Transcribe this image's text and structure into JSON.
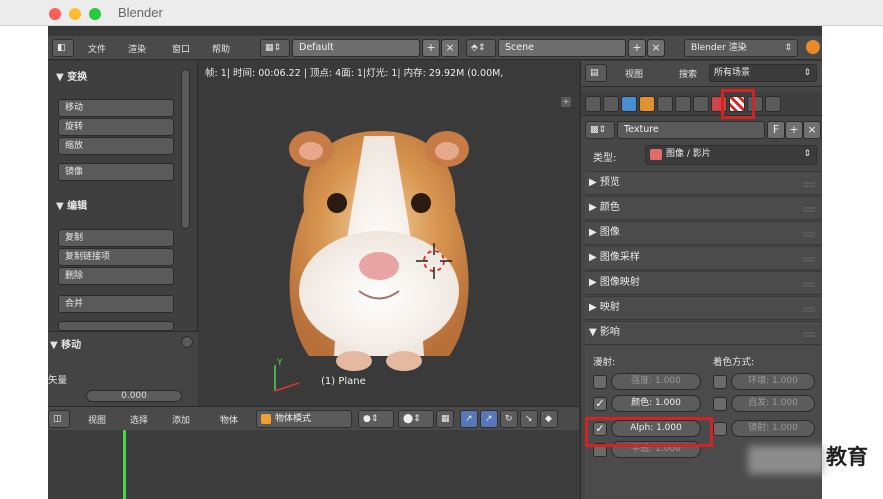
{
  "window": {
    "title": "Blender"
  },
  "header": {
    "menu": [
      "文件",
      "渲染",
      "窗口",
      "帮助"
    ],
    "screen_layout": "Default",
    "scene": "Scene",
    "render_engine": "Blender 渲染"
  },
  "left_panel": {
    "transform": {
      "title": "▼ 变换",
      "buttons": [
        "移动",
        "旋转",
        "缩放",
        "镜像"
      ]
    },
    "edit": {
      "title": "▼ 编辑",
      "buttons": [
        "复制",
        "复制链接项",
        "删除",
        "合并"
      ]
    },
    "operator_title": "▼ 移动",
    "vector_label": "矢量",
    "vector_x": "0.000"
  },
  "viewport": {
    "info": "帧: 1| 时间: 00:06.22 | 顶点: 4面: 1|灯光: 1| 内存: 29.92M (0.00M,",
    "object_label": "(1) Plane",
    "axis_y": "Y"
  },
  "viewport_header": {
    "view": "视图",
    "select": "选择",
    "add": "添加",
    "object": "物体",
    "mode": "物体模式"
  },
  "properties": {
    "view": "视图",
    "search": "搜索",
    "filter": "所有场景",
    "texture_name": "Texture",
    "type_label": "类型:",
    "type_value": "图像 / 影片",
    "panels": [
      "▶ 预览",
      "▶ 颜色",
      "▶ 图像",
      "▶ 图像采样",
      "▶ 图像映射",
      "▶ 映射",
      "▼ 影响"
    ],
    "influence": {
      "diffuse_label": "漫射:",
      "shading_label": "着色方式:",
      "intensity": "强度: 1.000",
      "color": "颜色: 1.000",
      "alpha": "Alph: 1.000",
      "translucency": "半透: 1.000",
      "ambient": "环境: 1.000",
      "emit": "自发: 1.000",
      "mirror": "镜射: 1.000"
    }
  },
  "watermark": "教育",
  "colors": {
    "highlight": "#d42323",
    "frame_cursor": "#47d647",
    "axis_y": "#4fd24f",
    "axis_x": "#e03434"
  }
}
